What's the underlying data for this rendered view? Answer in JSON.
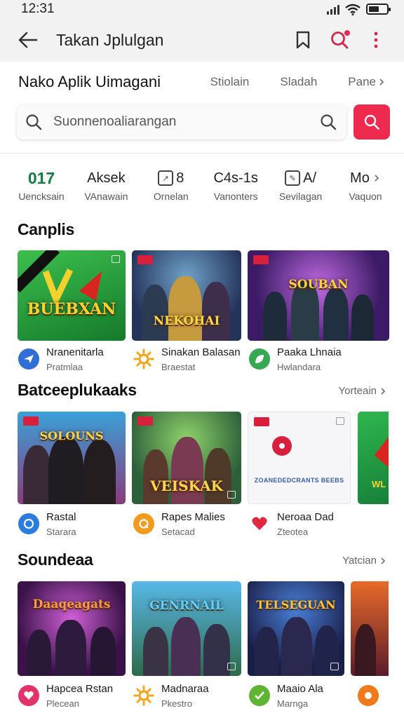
{
  "status_bar": {
    "time": "12:31"
  },
  "app_bar": {
    "title": "Takan Jplulgan"
  },
  "header": {
    "title": "Nako Aplik Uimagani",
    "links": [
      "Stiolain",
      "Sladah",
      "Pane"
    ]
  },
  "search": {
    "placeholder": "Suonnenoaliarangan"
  },
  "stats": [
    {
      "value": "017",
      "label": "Uencksain",
      "accent": true
    },
    {
      "value": "Aksek",
      "label": "VAnawain"
    },
    {
      "value": "8",
      "label": "Ornelan",
      "icon": "chart-icon"
    },
    {
      "value": "C4s-1s",
      "label": "Vanonters"
    },
    {
      "value": "A/",
      "label": "Sevilagan",
      "icon": "note-icon"
    },
    {
      "value": "Mo",
      "label": "Vaquon",
      "chevron": true
    }
  ],
  "sections": [
    {
      "title": "Canplis",
      "more": "",
      "items": [
        {
          "art_text": "BUEBXAN",
          "name": "Nranenitarla",
          "sub": "Pratmlaa",
          "icon": "plane-icon",
          "icon_color": "#2f6fd6"
        },
        {
          "art_text": "NEKOHAI",
          "name": "Sinakan Balasan",
          "sub": "Braestat",
          "icon": "sun-icon",
          "icon_color": "#f2a516"
        },
        {
          "art_text": "SOUBAN",
          "name": "Paaka Lhnaia",
          "sub": "Hwlandara",
          "icon": "leaf-icon",
          "icon_color": "#36a851"
        }
      ]
    },
    {
      "title": "Batceeplukaaks",
      "more": "Yorteain",
      "items": [
        {
          "art_text": "SOLOUNS",
          "name": "Rastal",
          "sub": "Starara",
          "icon": "chat-icon",
          "icon_color": "#2b7ce0"
        },
        {
          "art_text": "VEISKAK",
          "name": "Rapes Malies",
          "sub": "Setacad",
          "icon": "q-icon",
          "icon_color": "#f29a1c"
        },
        {
          "art_text": "ZOANEDEDCRANTS BEEBS",
          "name": "Neroaa Dad",
          "sub": "Zteotea",
          "icon": "heart-icon",
          "icon_color": "#e0283e"
        },
        {
          "art_text": "WL",
          "name": "",
          "sub": "",
          "icon": "",
          "icon_color": ""
        }
      ]
    },
    {
      "title": "Soundeaa",
      "more": "Yatcian",
      "items": [
        {
          "art_text": "Daaqeagats",
          "name": "Hapcea Rstan",
          "sub": "Plecean",
          "icon": "heart-icon",
          "icon_color": "#e3336b"
        },
        {
          "art_text": "GENRNAIL",
          "name": "Madnaraa",
          "sub": "Pkestro",
          "icon": "sun-icon",
          "icon_color": "#f2a516"
        },
        {
          "art_text": "TELSEGUAN",
          "name": "Maaio Ala",
          "sub": "Marnga",
          "icon": "check-icon",
          "icon_color": "#5fb533"
        },
        {
          "art_text": "",
          "name": "",
          "sub": "",
          "icon": "circle-icon",
          "icon_color": "#f07a1a"
        }
      ]
    }
  ],
  "colors": {
    "accent": "#ee2a4f",
    "green": "#157a45"
  }
}
